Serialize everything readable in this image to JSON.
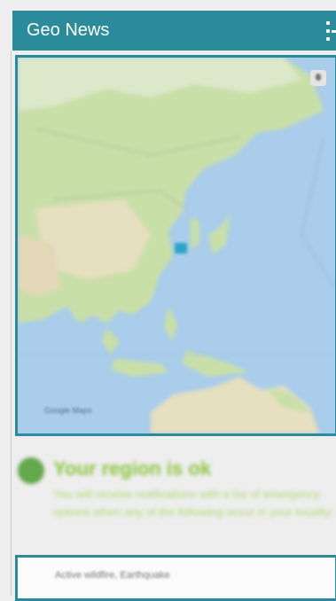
{
  "app": {
    "title": "Geo News",
    "menu_icon": "list-menu-icon"
  },
  "map": {
    "locate_icon": "location-pin-icon",
    "watermark": "Google Maps"
  },
  "region_status": {
    "title": "Your region is ok",
    "description": "You will receive notifications with a list of emergency options when any of the following occur in your locality:",
    "status_color": "#8cc43f"
  },
  "alerts": {
    "summary": "Active wildfire, Earthquake"
  },
  "colors": {
    "accent": "#2c8b9a",
    "ok_green": "#63a84a"
  }
}
